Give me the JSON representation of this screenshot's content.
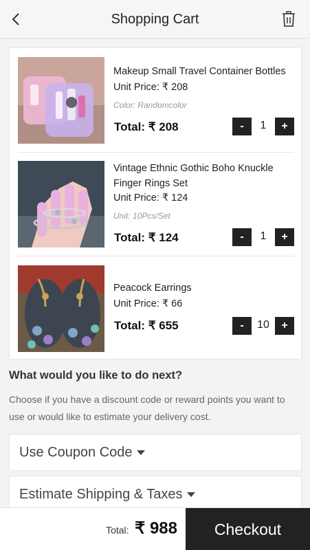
{
  "header": {
    "title": "Shopping Cart",
    "back_icon": "chevron-left-icon",
    "trash_icon": "trash-icon"
  },
  "cart": {
    "items": [
      {
        "name": "Makeup Small Travel Container Bottles",
        "unit_price": "Unit Price: ₹ 208",
        "attribute": "Color: Randomcolor",
        "total": "Total: ₹ 208",
        "quantity": "1"
      },
      {
        "name": "Vintage Ethnic Gothic Boho Knuckle Finger Rings Set",
        "unit_price": "Unit Price: ₹ 124",
        "attribute": "Unit: 10Pcs/Set",
        "total": "Total: ₹ 124",
        "quantity": "1"
      },
      {
        "name": "Peacock Earrings",
        "unit_price": "Unit Price: ₹ 66",
        "attribute": "",
        "total": "Total: ₹ 655",
        "quantity": "10"
      }
    ],
    "minus_label": "-",
    "plus_label": "+"
  },
  "next": {
    "title": "What would you like to do next?",
    "description": "Choose if you have a discount code or reward points you want to use or would like to estimate your delivery cost."
  },
  "options": {
    "coupon_label": "Use Coupon Code",
    "shipping_label": "Estimate Shipping & Taxes"
  },
  "footer": {
    "total_label": "Total:",
    "total_amount": "₹ 988",
    "checkout_label": "Checkout"
  },
  "colors": {
    "button_dark": "#222222",
    "background": "#f3f3f5"
  }
}
